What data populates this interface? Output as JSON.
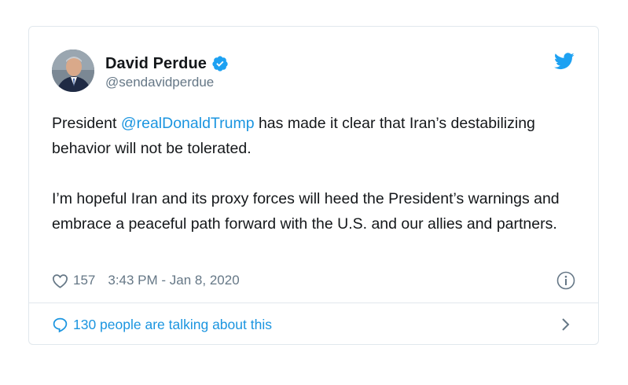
{
  "author": {
    "display_name": "David Perdue",
    "handle": "@sendavidperdue",
    "verified": true
  },
  "tweet": {
    "paragraph1_prefix": "President ",
    "paragraph1_mention": "@realDonaldTrump",
    "paragraph1_suffix": " has made it clear that Iran’s destabilizing behavior will not be tolerated.",
    "paragraph2": "I’m hopeful Iran and its proxy forces will heed the President’s warnings and embrace a peaceful path forward with the U.S. and our allies and partners."
  },
  "meta": {
    "likes": "157",
    "timestamp": "3:43 PM - Jan 8, 2020"
  },
  "footer": {
    "talking_label": "130 people are talking about this"
  },
  "icons": {
    "brand": "twitter-bird-icon",
    "verified": "verified-badge-icon",
    "like": "heart-icon",
    "info": "info-icon",
    "reply": "speech-bubble-icon",
    "chevron": "chevron-right-icon"
  },
  "colors": {
    "brand_blue": "#1da1f2",
    "link_blue": "#1b95e0",
    "text": "#14171a",
    "secondary_text": "#657786",
    "border": "#e1e8ed"
  }
}
